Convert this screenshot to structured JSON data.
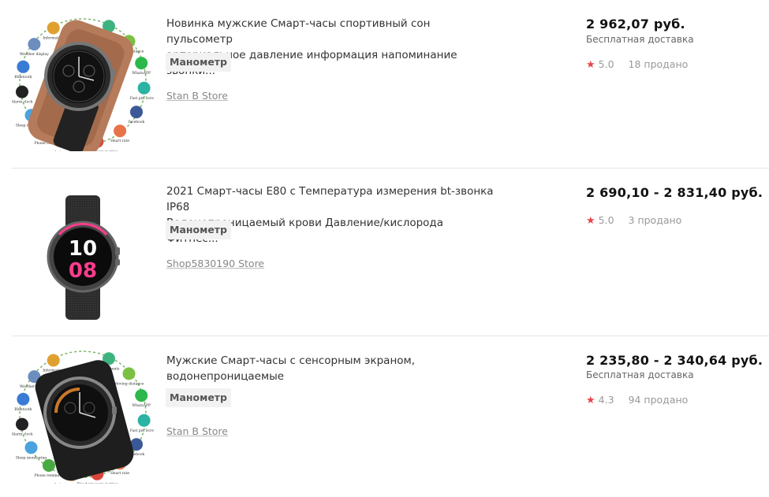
{
  "products": [
    {
      "title_line1": "Новинка мужские Смарт-часы спортивный сон пульсометр",
      "title_line2": "артериальное давление информация напоминание звонки...",
      "tag": "Манометр",
      "store": "Stan B Store",
      "price": "2 962,07 руб.",
      "shipping": "Бесплатная доставка",
      "rating": "5.0",
      "sold": "18 продано",
      "image_icon": "smartwatch-brown-strap-features-icon",
      "feature_labels": [
        "Step counts",
        "Moving distance",
        "WhatsAPP",
        "Fast pin Screen",
        "facebook",
        "Heart rate",
        "Blood pressure testing",
        "Sedentary reminder",
        "Phone reminder",
        "Sleep monitoring",
        "Alarm clock",
        "Bluetooth",
        "Weather display",
        "Information"
      ]
    },
    {
      "title_line1": "2021 Смарт-часы E80 с Температура измерения bt-звонка IP68",
      "title_line2": "Водонепроницаемый крови Давление/кислорода Фитнес...",
      "tag": "Манометр",
      "store": "Shop5830190 Store",
      "price": "2 690,10 - 2 831,40 руб.",
      "shipping": "",
      "rating": "5.0",
      "sold": "3 продано",
      "image_icon": "smartwatch-black-mesh-icon",
      "watch_time_h": "10",
      "watch_time_m": "08"
    },
    {
      "title_line1": "Мужские Смарт-часы с сенсорным экраном,",
      "title_line2": "водонепроницаемые",
      "tag": "Манометр",
      "store": "Stan B Store",
      "price": "2 235,80 - 2 340,64 руб.",
      "shipping": "Бесплатная доставка",
      "rating": "4.3",
      "sold": "94 продано",
      "image_icon": "smartwatch-black-strap-features-icon",
      "feature_labels": [
        "Step counts",
        "Moving distance",
        "WhatsAPP",
        "Fast pin Screen",
        "facebook",
        "Heart rate",
        "Blood pressure testing",
        "Sedentary reminder",
        "Phone reminder",
        "Sleep monitoring",
        "Alarm clock",
        "Bluetooth",
        "Weather display",
        "Information"
      ]
    }
  ],
  "colors": {
    "star": "#e8434a",
    "price": "#111111",
    "separator": "#e6e6e6",
    "tag_bg": "#f2f2f2",
    "watch_pink": "#ff3c8c"
  }
}
